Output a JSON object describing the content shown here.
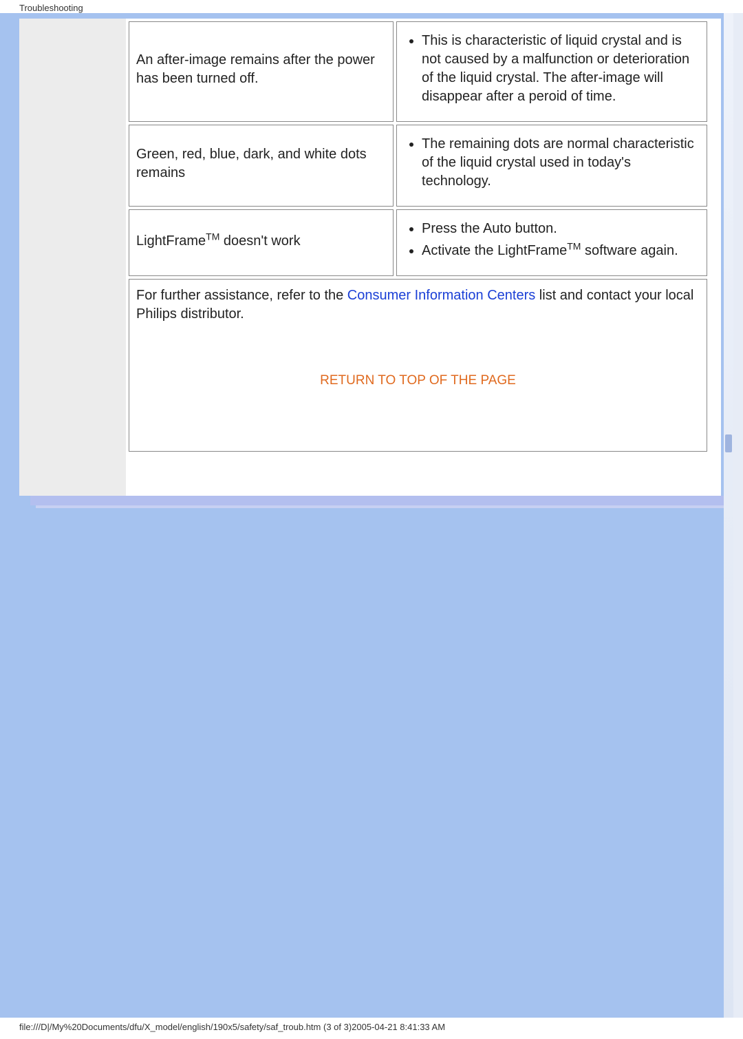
{
  "header": {
    "title": "Troubleshooting"
  },
  "table": {
    "rows": [
      {
        "symptom": "An after-image remains after the power has been turned off.",
        "solutions": [
          "This is characteristic of liquid crystal and is not caused by a malfunction or deterioration of the liquid crystal. The after-image will disappear after a peroid of time."
        ]
      },
      {
        "symptom": "Green, red, blue, dark, and white dots remains",
        "solutions": [
          "The remaining dots are normal characteristic of the liquid crystal used in today's technology."
        ]
      },
      {
        "symptom_html": "LightFrame<span class=\"sup\">TM</span> doesn't work",
        "symptom": "LightFrameTM doesn't work",
        "solutions": [
          "Press the Auto button.",
          "Activate the LightFrame<span class=\"sup\">TM</span> software again."
        ],
        "solutions_plain": [
          "Press the Auto button.",
          "Activate the LightFrameTM software again."
        ]
      }
    ]
  },
  "footer_note": {
    "prefix": "For further assistance, refer to the ",
    "link_text": "Consumer Information Centers",
    "suffix": " list and contact your local Philips distributor."
  },
  "return_link": "RETURN TO TOP OF THE PAGE",
  "status_bar": "file:///D|/My%20Documents/dfu/X_model/english/190x5/safety/saf_troub.htm (3 of 3)2005-04-21 8:41:33 AM"
}
